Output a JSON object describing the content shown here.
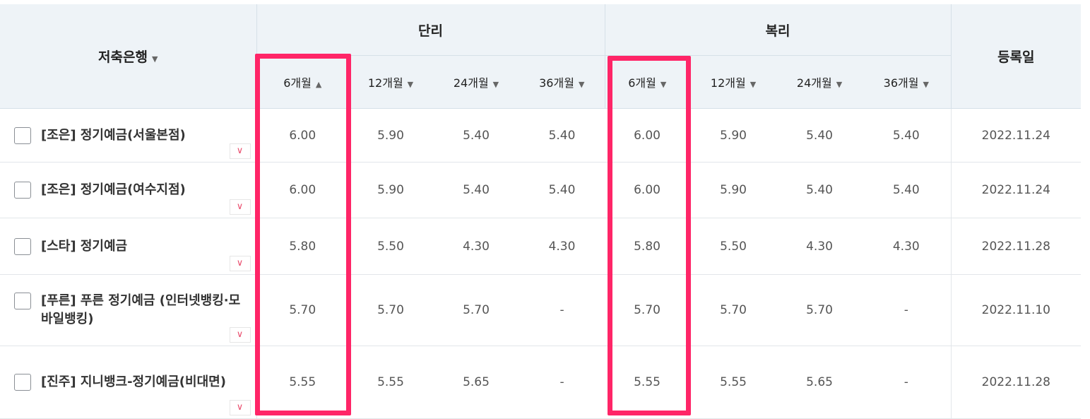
{
  "header": {
    "bank_col": "저축은행",
    "simple_group": "단리",
    "compound_group": "복리",
    "date_col": "등록일",
    "sort_up_icon": "▲",
    "sort_down_icon": "▼",
    "periods": [
      "6개월",
      "12개월",
      "24개월",
      "36개월"
    ]
  },
  "highlight_color": "#ff2567",
  "expand_icon": "chevron-down",
  "rows": [
    {
      "bank": "[조은] 정기예금(서울본점)",
      "simple": [
        "6.00",
        "5.90",
        "5.40",
        "5.40"
      ],
      "compound": [
        "6.00",
        "5.90",
        "5.40",
        "5.40"
      ],
      "date": "2022.11.24"
    },
    {
      "bank": "[조은] 정기예금(여수지점)",
      "simple": [
        "6.00",
        "5.90",
        "5.40",
        "5.40"
      ],
      "compound": [
        "6.00",
        "5.90",
        "5.40",
        "5.40"
      ],
      "date": "2022.11.24"
    },
    {
      "bank": "[스타] 정기예금",
      "simple": [
        "5.80",
        "5.50",
        "4.30",
        "4.30"
      ],
      "compound": [
        "5.80",
        "5.50",
        "4.30",
        "4.30"
      ],
      "date": "2022.11.28"
    },
    {
      "bank": "[푸른] 푸른 정기예금 (인터넷뱅킹·모바일뱅킹)",
      "simple": [
        "5.70",
        "5.70",
        "5.70",
        "-"
      ],
      "compound": [
        "5.70",
        "5.70",
        "5.70",
        "-"
      ],
      "date": "2022.11.10"
    },
    {
      "bank": "[진주] 지니뱅크-정기예금(비대면)",
      "simple": [
        "5.55",
        "5.55",
        "5.65",
        "-"
      ],
      "compound": [
        "5.55",
        "5.55",
        "5.65",
        "-"
      ],
      "date": "2022.11.28"
    }
  ]
}
